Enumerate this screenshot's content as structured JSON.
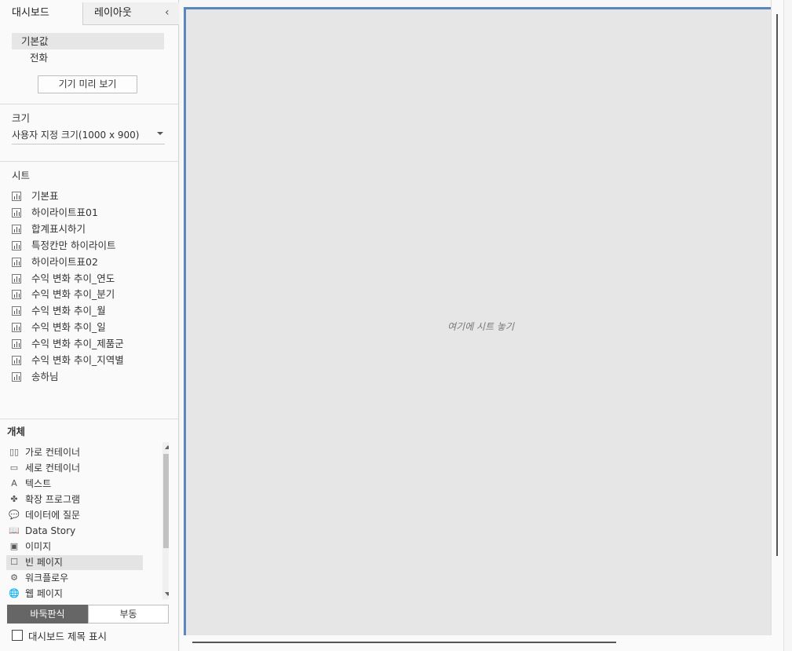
{
  "tabs": {
    "dashboard": "대시보드",
    "layout": "레이아웃",
    "collapse_icon": "chevron-left-icon"
  },
  "devices": {
    "default": "기본값",
    "phone": "전화",
    "preview_button": "기기 미리 보기"
  },
  "size": {
    "title": "크기",
    "selected": "사용자 지정 크기(1000 x 900)"
  },
  "sheets": {
    "title": "시트",
    "items": [
      "기본표",
      "하이라이트표01",
      "합계표시하기",
      "특정칸만 하이라이트",
      "하이라이트표02",
      "수익 변화 추이_연도",
      "수익 변화 추이_분기",
      "수익 변화 추이_월",
      "수익 변화 추이_일",
      "수익 변화 추이_제품군",
      "수익 변화 추이_지역별",
      "송하님"
    ]
  },
  "objects": {
    "title": "개체",
    "items": [
      {
        "label": "가로 컨테이너",
        "icon": "horizontal-container-icon",
        "glyph": "▯▯"
      },
      {
        "label": "세로 컨테이너",
        "icon": "vertical-container-icon",
        "glyph": "▭"
      },
      {
        "label": "텍스트",
        "icon": "text-icon",
        "glyph": "A"
      },
      {
        "label": "확장 프로그램",
        "icon": "extension-icon",
        "glyph": "✤"
      },
      {
        "label": "데이터에 질문",
        "icon": "ask-data-icon",
        "glyph": "💬"
      },
      {
        "label": "Data Story",
        "icon": "book-icon",
        "glyph": "📖"
      },
      {
        "label": "이미지",
        "icon": "image-icon",
        "glyph": "▣"
      },
      {
        "label": "빈 페이지",
        "icon": "blank-icon",
        "glyph": "☐"
      },
      {
        "label": "워크플로우",
        "icon": "workflow-icon",
        "glyph": "⚙"
      },
      {
        "label": "웹 페이지",
        "icon": "globe-icon",
        "glyph": "🌐"
      }
    ]
  },
  "layout_mode": {
    "tiled": "바둑판식",
    "floating": "부동"
  },
  "show_title_label": "대시보드 제목 표시",
  "canvas": {
    "drop_hint": "여기에 시트 놓기"
  },
  "colors": {
    "canvas_border": "#5b86bd",
    "selected_segment": "#666666"
  }
}
